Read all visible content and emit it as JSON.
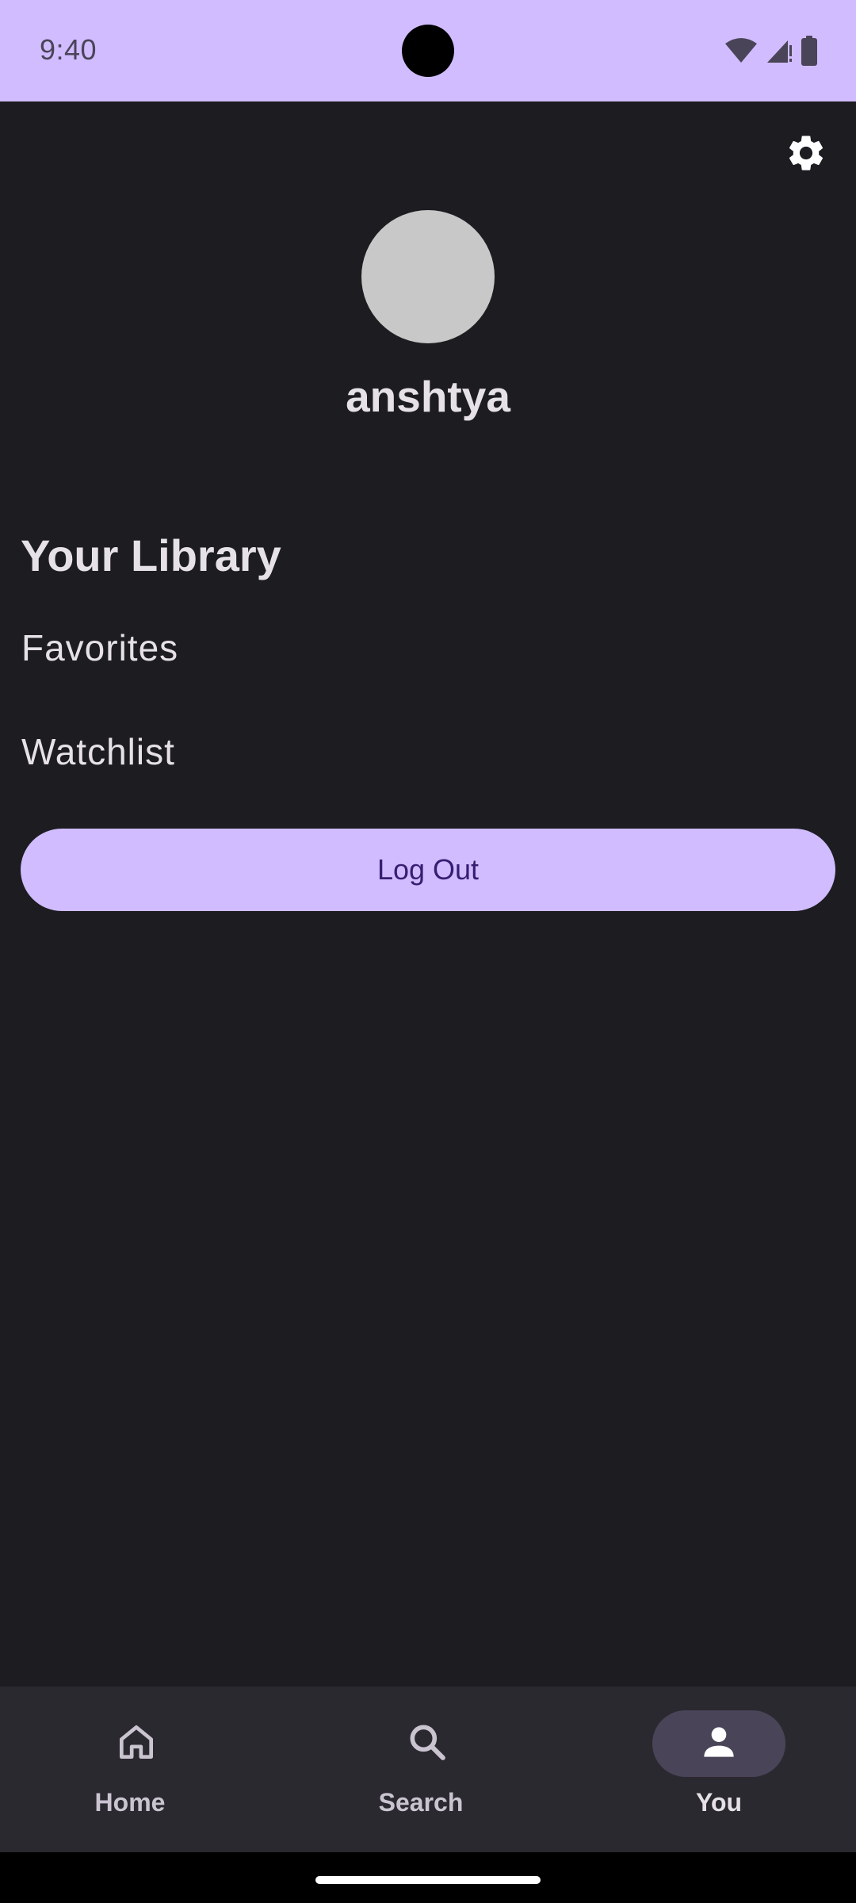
{
  "status_bar": {
    "time": "9:40",
    "icons": [
      "wifi-icon",
      "cellular-signal-icon",
      "battery-icon"
    ],
    "background": "#d0bcfe"
  },
  "header": {
    "settings_icon": "gear-icon"
  },
  "profile": {
    "username": "anshtya",
    "avatar_color": "#c8c8c8"
  },
  "library": {
    "heading": "Your Library",
    "items": [
      {
        "label": "Favorites"
      },
      {
        "label": "Watchlist"
      }
    ]
  },
  "logout": {
    "label": "Log Out",
    "color": "#d0bcfe"
  },
  "bottom_nav": {
    "items": [
      {
        "label": "Home",
        "icon": "home-icon",
        "selected": false
      },
      {
        "label": "Search",
        "icon": "search-icon",
        "selected": false
      },
      {
        "label": "You",
        "icon": "person-icon",
        "selected": true
      }
    ]
  },
  "colors": {
    "background": "#1d1c21",
    "accent": "#d0bcfe",
    "nav_background": "#2b2930",
    "selected_pill": "#4a4458"
  }
}
